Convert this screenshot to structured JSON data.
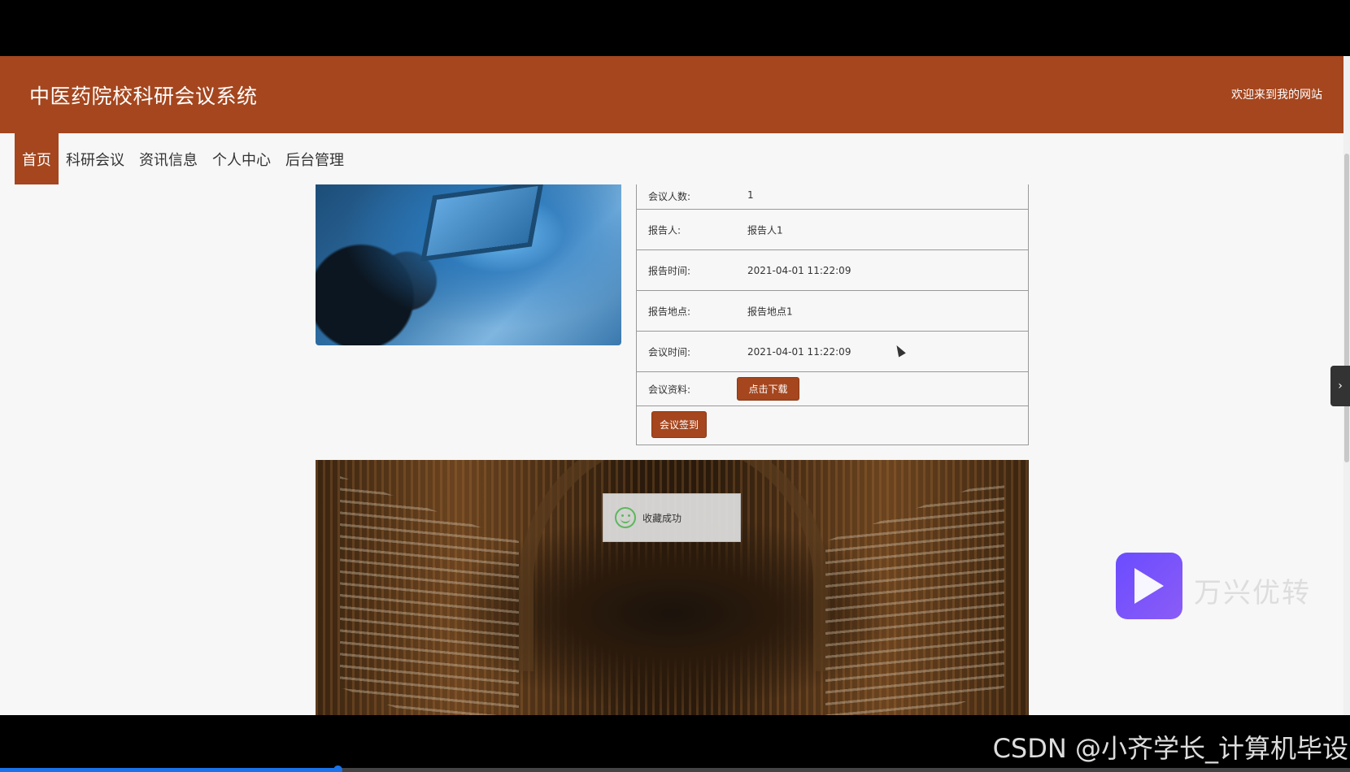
{
  "header": {
    "title": "中医药院校科研会议系统",
    "welcome": "欢迎来到我的网站"
  },
  "nav": [
    {
      "label": "首页",
      "active": true
    },
    {
      "label": "科研会议",
      "active": false
    },
    {
      "label": "资讯信息",
      "active": false
    },
    {
      "label": "个人中心",
      "active": false
    },
    {
      "label": "后台管理",
      "active": false
    }
  ],
  "details": {
    "rows": [
      {
        "label": "会议人数:",
        "value": "1"
      },
      {
        "label": "报告人:",
        "value": "报告人1"
      },
      {
        "label": "报告时间:",
        "value": "2021-04-01 11:22:09"
      },
      {
        "label": "报告地点:",
        "value": "报告地点1"
      },
      {
        "label": "会议时间:",
        "value": "2021-04-01 11:22:09"
      }
    ],
    "material_label": "会议资料:",
    "download_button": "点击下载",
    "sign_button": "会议签到"
  },
  "toast": {
    "text": "收藏成功",
    "icon": "smile-icon"
  },
  "side_tab": {
    "icon": "chevron-right-icon",
    "glyph": "›"
  },
  "watermark": {
    "text": "万兴优转",
    "icon": "play-logo-icon"
  },
  "overlay_credit": "CSDN @小齐学长_计算机毕设",
  "video_progress": 0.25,
  "colors": {
    "brand": "#a5461e",
    "page_bg": "#f7f7f7"
  }
}
